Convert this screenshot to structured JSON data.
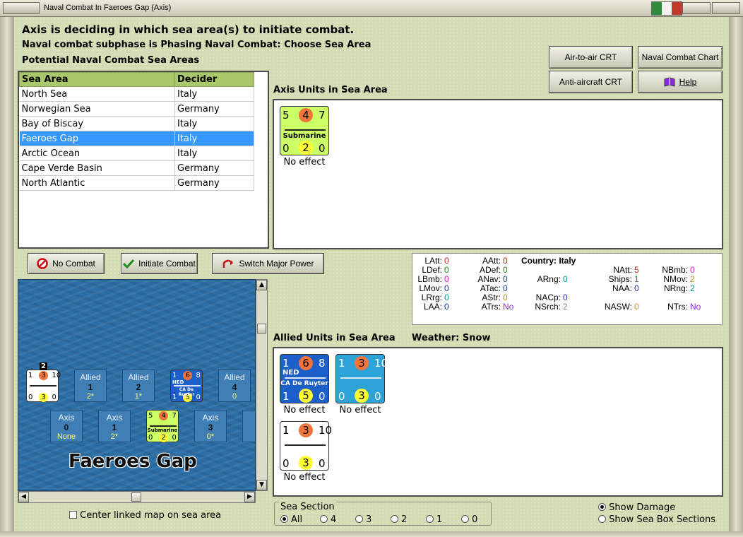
{
  "window": {
    "title": "Naval Combat In Faeroes Gap (Axis)"
  },
  "headers": {
    "line1": "Axis is deciding in which sea area(s) to initiate combat.",
    "line2": "Naval combat subphase is Phasing Naval Combat: Choose Sea Area",
    "line3": "Potential Naval Combat Sea Areas"
  },
  "buttons": {
    "air_to_air": "Air-to-air CRT",
    "naval_chart": "Naval Combat Chart",
    "anti_aircraft": "Anti-aircraft CRT",
    "help": "Help",
    "no_combat": "No Combat",
    "initiate": "Initiate Combat",
    "switch_major": "Switch Major Power"
  },
  "sea_table": {
    "headers": [
      "Sea Area",
      "Decider"
    ],
    "rows": [
      [
        "North Sea",
        "Italy"
      ],
      [
        "Norwegian Sea",
        "Germany"
      ],
      [
        "Bay of Biscay",
        "Italy"
      ],
      [
        "Faeroes Gap",
        "Italy"
      ],
      [
        "Arctic Ocean",
        "Italy"
      ],
      [
        "Cape Verde Basin",
        "Germany"
      ],
      [
        "North Atlantic",
        "Germany"
      ]
    ],
    "selected": 3
  },
  "axis_units": {
    "label": "Axis Units in Sea Area",
    "units": [
      {
        "top": [
          "5",
          "4",
          "7"
        ],
        "name": "Submarine",
        "bottom": [
          "0",
          "2",
          "0"
        ],
        "effect": "No effect",
        "color": "#ccff66"
      }
    ]
  },
  "allied_units": {
    "label": "Allied Units in Sea Area",
    "weather_label": "Weather:",
    "weather": "Snow",
    "units": [
      {
        "top": [
          "1",
          "6",
          "8"
        ],
        "nat": "NED",
        "name": "CA De Ruyter",
        "bottom": [
          "1",
          "5",
          "0"
        ],
        "effect": "No effect",
        "color": "#1c5fc8"
      },
      {
        "top": [
          "1",
          "3",
          "10"
        ],
        "nat": "",
        "name": "",
        "bottom": [
          "0",
          "3",
          "0"
        ],
        "effect": "No effect",
        "color": "#2ea3d8"
      },
      {
        "top": [
          "1",
          "3",
          "10"
        ],
        "nat": "",
        "name": "",
        "bottom": [
          "0",
          "3",
          "0"
        ],
        "effect": "No effect",
        "color": "#ffffff"
      }
    ]
  },
  "stats": {
    "country_label": "Country:",
    "country": "Italy",
    "col1": [
      [
        "LAtt:",
        "0"
      ],
      [
        "LDef:",
        "0"
      ],
      [
        "LBmb:",
        "0"
      ],
      [
        "LMov:",
        "0"
      ],
      [
        "LRrg:",
        "0"
      ],
      [
        "LAA:",
        "0"
      ]
    ],
    "col2": [
      [
        "AAtt:",
        "0"
      ],
      [
        "ADef:",
        "0"
      ],
      [
        "ANav:",
        "0"
      ],
      [
        "ATac:",
        "0"
      ],
      [
        "AStr:",
        "0"
      ],
      [
        "ATrs:",
        "No"
      ]
    ],
    "col3": [
      [
        "ARng:",
        "0"
      ],
      [
        "NACp:",
        "0"
      ],
      [
        "NSrch:",
        "2"
      ]
    ],
    "col4": [
      [
        "NAtt:",
        "5"
      ],
      [
        "Ships:",
        "1"
      ],
      [
        "NAA:",
        "0"
      ],
      [
        "NASW:",
        "0"
      ]
    ],
    "col5": [
      [
        "NBmb:",
        "0"
      ],
      [
        "NMov:",
        "2"
      ],
      [
        "NRng:",
        "2"
      ],
      [
        "NTrs:",
        "No"
      ]
    ]
  },
  "map": {
    "sea_name": "Faeroes Gap",
    "allied_boxes": [
      {
        "side": "Allied",
        "num": "1",
        "val": "2*"
      },
      {
        "side": "Allied",
        "num": "2",
        "val": "1*"
      },
      {
        "side": "Allied",
        "num": "4",
        "val": "0"
      }
    ],
    "axis_boxes": [
      {
        "side": "Axis",
        "num": "0",
        "val": "None"
      },
      {
        "side": "Axis",
        "num": "1",
        "val": "2*"
      },
      {
        "side": "Axis",
        "num": "3",
        "val": "0*"
      },
      {
        "side": "A",
        "num": "",
        "val": ""
      }
    ],
    "stack_count": "2",
    "ned_counter": {
      "top": [
        "1",
        "6",
        "8"
      ],
      "nat": "NED",
      "name": "CA De Ruyter",
      "bottom": [
        "1",
        "5",
        "0"
      ]
    },
    "white_counter": {
      "top": [
        "1",
        "3",
        "10"
      ],
      "bottom": [
        "0",
        "3",
        "0"
      ]
    },
    "sub_counter": {
      "top": [
        "5",
        "4",
        "7"
      ],
      "name": "Submarine",
      "bottom": [
        "0",
        "2",
        "0"
      ]
    }
  },
  "footer": {
    "center_map": "Center linked map on sea area",
    "sea_section": "Sea Section",
    "sections": [
      "All",
      "4",
      "3",
      "2",
      "1",
      "0"
    ],
    "show_damage": "Show Damage",
    "show_boxes": "Show Sea Box Sections"
  }
}
